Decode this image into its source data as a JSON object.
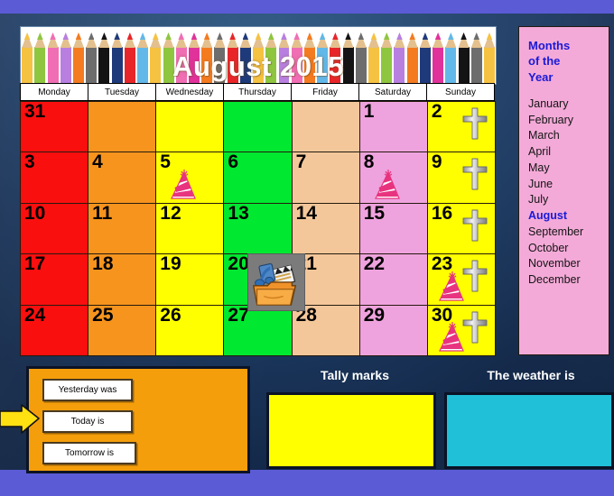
{
  "theme": {
    "slide_border_color": "#5b5bd6",
    "background_color": "#1d3d68",
    "title_text_color": "#ffffff",
    "months_panel_color": "#f4aad8",
    "months_highlight_color": "#1a1ad6",
    "day_panel_color": "#f59e0b",
    "tally_box_color": "#ffff00",
    "weather_box_color": "#20c0d8",
    "arrow_color": "#ffe011"
  },
  "calendar": {
    "title": "August 2015",
    "month_name": "August",
    "year": "2015",
    "banner_icon": "colored-pencils-border",
    "weekdays": [
      "Monday",
      "Tuesday",
      "Wednesday",
      "Thursday",
      "Friday",
      "Saturday",
      "Sunday"
    ],
    "column_colors": [
      "#fa0f0f",
      "#f7941e",
      "#ffff00",
      "#00e830",
      "#f4c79a",
      "#efa3de",
      "#ffff00"
    ],
    "weeks": [
      [
        {
          "num": "31",
          "other_month": true,
          "icons": []
        },
        {
          "num": "",
          "other_month": true,
          "icons": []
        },
        {
          "num": "",
          "other_month": true,
          "icons": []
        },
        {
          "num": "",
          "other_month": true,
          "icons": []
        },
        {
          "num": "",
          "other_month": true,
          "icons": []
        },
        {
          "num": "1",
          "other_month": false,
          "icons": []
        },
        {
          "num": "2",
          "other_month": false,
          "icons": [
            "cross-icon"
          ]
        }
      ],
      [
        {
          "num": "3",
          "other_month": false,
          "icons": []
        },
        {
          "num": "4",
          "other_month": false,
          "icons": []
        },
        {
          "num": "5",
          "other_month": false,
          "icons": [
            "party-hat-icon"
          ]
        },
        {
          "num": "6",
          "other_month": false,
          "icons": []
        },
        {
          "num": "7",
          "other_month": false,
          "icons": []
        },
        {
          "num": "8",
          "other_month": false,
          "icons": [
            "party-hat-icon"
          ]
        },
        {
          "num": "9",
          "other_month": false,
          "icons": [
            "cross-icon"
          ]
        }
      ],
      [
        {
          "num": "10",
          "other_month": false,
          "icons": []
        },
        {
          "num": "11",
          "other_month": false,
          "icons": []
        },
        {
          "num": "12",
          "other_month": false,
          "icons": []
        },
        {
          "num": "13",
          "other_month": false,
          "icons": []
        },
        {
          "num": "14",
          "other_month": false,
          "icons": []
        },
        {
          "num": "15",
          "other_month": false,
          "icons": []
        },
        {
          "num": "16",
          "other_month": false,
          "icons": [
            "cross-icon"
          ]
        }
      ],
      [
        {
          "num": "17",
          "other_month": false,
          "icons": []
        },
        {
          "num": "18",
          "other_month": false,
          "icons": []
        },
        {
          "num": "19",
          "other_month": false,
          "icons": []
        },
        {
          "num": "20",
          "other_month": false,
          "icons": []
        },
        {
          "num": "21",
          "other_month": false,
          "icons": []
        },
        {
          "num": "22",
          "other_month": false,
          "icons": []
        },
        {
          "num": "23",
          "other_month": false,
          "icons": [
            "party-hat-icon",
            "cross-icon"
          ]
        }
      ],
      [
        {
          "num": "24",
          "other_month": false,
          "icons": []
        },
        {
          "num": "25",
          "other_month": false,
          "icons": []
        },
        {
          "num": "26",
          "other_month": false,
          "icons": []
        },
        {
          "num": "27",
          "other_month": false,
          "icons": []
        },
        {
          "num": "28",
          "other_month": false,
          "icons": []
        },
        {
          "num": "29",
          "other_month": false,
          "icons": []
        },
        {
          "num": "30",
          "other_month": false,
          "icons": [
            "party-hat-icon",
            "cross-icon"
          ]
        }
      ]
    ]
  },
  "media_icon": {
    "name": "media-folder-icon",
    "description": "orange folder with music note and film clapperboard"
  },
  "months_panel": {
    "title_line_1": "Months",
    "title_line_2": "of the",
    "title_line_3": "Year",
    "months": [
      "January",
      "February",
      "March",
      "April",
      "May",
      "June",
      "July",
      "August",
      "September",
      "October",
      "November",
      "December"
    ],
    "current_month": "August"
  },
  "day_panel": {
    "yesterday_label": "Yesterday was",
    "today_label": "Today is",
    "tomorrow_label": "Tomorrow is"
  },
  "tally": {
    "label": "Tally marks",
    "value": ""
  },
  "weather": {
    "label": "The weather is",
    "value": ""
  }
}
